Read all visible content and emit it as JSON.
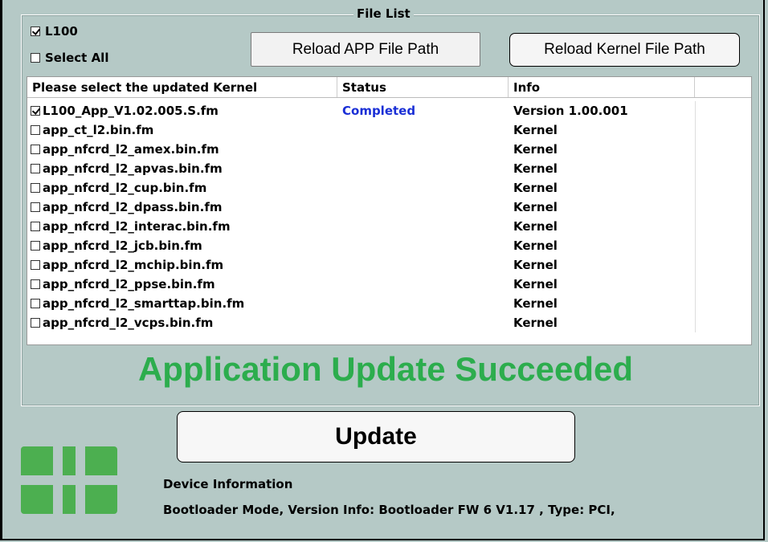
{
  "group": {
    "title": "File List"
  },
  "checks": {
    "l100": {
      "label": "L100",
      "checked": true
    },
    "select_all": {
      "label": "Select All",
      "checked": false
    }
  },
  "buttons": {
    "reload_app": "Reload APP File Path",
    "reload_kernel": "Reload Kernel File Path",
    "update": "Update"
  },
  "table": {
    "columns": [
      "Please select the updated Kernel",
      "Status",
      "Info",
      ""
    ],
    "rows": [
      {
        "name": "L100_App_V1.02.005.S.fm",
        "checked": true,
        "status": "Completed",
        "info": "Version 1.00.001"
      },
      {
        "name": "app_ct_l2.bin.fm",
        "checked": false,
        "status": "",
        "info": "Kernel"
      },
      {
        "name": "app_nfcrd_l2_amex.bin.fm",
        "checked": false,
        "status": "",
        "info": "Kernel"
      },
      {
        "name": "app_nfcrd_l2_apvas.bin.fm",
        "checked": false,
        "status": "",
        "info": "Kernel"
      },
      {
        "name": "app_nfcrd_l2_cup.bin.fm",
        "checked": false,
        "status": "",
        "info": "Kernel"
      },
      {
        "name": "app_nfcrd_l2_dpass.bin.fm",
        "checked": false,
        "status": "",
        "info": "Kernel"
      },
      {
        "name": "app_nfcrd_l2_interac.bin.fm",
        "checked": false,
        "status": "",
        "info": "Kernel"
      },
      {
        "name": "app_nfcrd_l2_jcb.bin.fm",
        "checked": false,
        "status": "",
        "info": "Kernel"
      },
      {
        "name": "app_nfcrd_l2_mchip.bin.fm",
        "checked": false,
        "status": "",
        "info": "Kernel"
      },
      {
        "name": "app_nfcrd_l2_ppse.bin.fm",
        "checked": false,
        "status": "",
        "info": "Kernel"
      },
      {
        "name": "app_nfcrd_l2_smarttap.bin.fm",
        "checked": false,
        "status": "",
        "info": "Kernel"
      },
      {
        "name": "app_nfcrd_l2_vcps.bin.fm",
        "checked": false,
        "status": "",
        "info": "Kernel"
      }
    ]
  },
  "banner": "Application Update Succeeded",
  "device": {
    "label": "Device Information",
    "info": "Bootloader Mode, Version Info: Bootloader FW 6 V1.17 , Type: PCI,"
  },
  "colors": {
    "background": "#b5c9c6",
    "success_green": "#2cad4d",
    "status_blue": "#1a2fd6",
    "logo_green": "#4caf50"
  },
  "icons": {
    "logo": "company-logo-icon"
  }
}
